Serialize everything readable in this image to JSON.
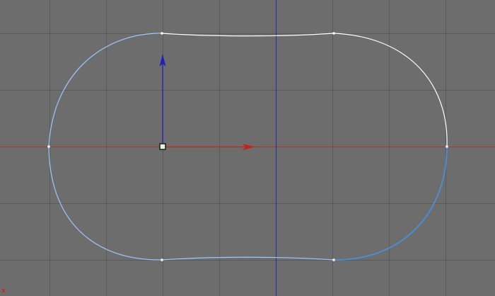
{
  "viewport": {
    "background": "#6d6d6d",
    "grid_color": "#5a5a5a",
    "axis_x_color": "#a33a2a",
    "axis_y_color": "#2a28a8",
    "corner_axis_label": "x",
    "corner_axis_label_color": "#c8271d"
  },
  "spline": {
    "shape": "rounded-rectangle closed spline",
    "selected_segment_color": "#ffffff",
    "unselected_segment_color": "#9cc8ff",
    "lower_right_segment_color": "#4b8fd8",
    "vertex_color": "#ffffff",
    "vertex_count": 6
  },
  "gizmo": {
    "x_arrow_color": "#c4251b",
    "y_arrow_color": "#1e23b6",
    "pivot_color": "#1c1c1c",
    "pivot_fill": "#e6f3d8"
  }
}
